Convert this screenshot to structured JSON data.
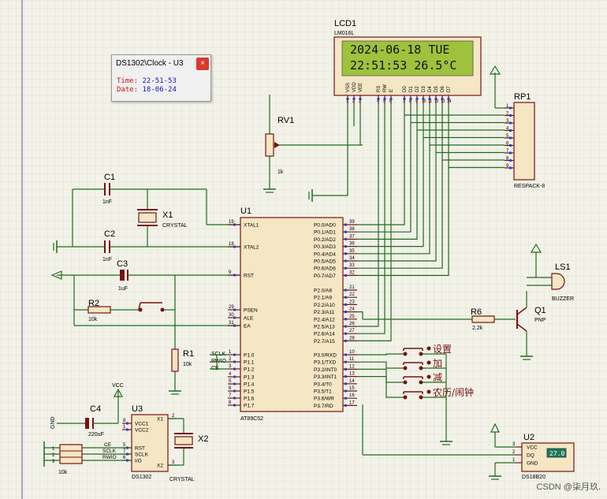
{
  "popup": {
    "title": "DS1302\\Clock - U3",
    "close_label": "×",
    "time_label": "Time:",
    "time_value": "22-51-53",
    "date_label": "Date:",
    "date_value": "18-06-24"
  },
  "lcd": {
    "ref": "LCD1",
    "model": "LM016L",
    "line1": "2024-06-18 TUE",
    "line2": "22:51:53  26.5°C",
    "pins": [
      "VSS",
      "VDD",
      "VEE",
      "RS",
      "RW",
      "E",
      "D0",
      "D1",
      "D2",
      "D3",
      "D4",
      "D5",
      "D6",
      "D7"
    ],
    "pin_numbers": [
      "1",
      "2",
      "3",
      "4",
      "5",
      "6",
      "7",
      "8",
      "9",
      "10",
      "11",
      "12",
      "13",
      "14"
    ]
  },
  "rv1": {
    "ref": "RV1",
    "value": "1k"
  },
  "rp1": {
    "ref": "RP1",
    "model": "RESPACK-8",
    "pins": [
      "1",
      "2",
      "3",
      "4",
      "5",
      "6",
      "7",
      "8",
      "9"
    ]
  },
  "c1": {
    "ref": "C1",
    "value": "1nF"
  },
  "c2": {
    "ref": "C2",
    "value": "1nF"
  },
  "c3": {
    "ref": "C3",
    "value": "1uF"
  },
  "c4": {
    "ref": "C4",
    "value": "220uF"
  },
  "x1": {
    "ref": "X1",
    "value": "CRYSTAL"
  },
  "x2": {
    "ref": "X2",
    "value": "CRYSTAL"
  },
  "r1": {
    "ref": "R1",
    "value": "10k"
  },
  "r2": {
    "ref": "R2",
    "value": "10k"
  },
  "r6": {
    "ref": "R6",
    "value": "2.2k"
  },
  "rn": {
    "value": "10k",
    "pins": [
      "1",
      "2",
      "3"
    ]
  },
  "ls1": {
    "ref": "LS1",
    "value": "BUZZER"
  },
  "q1": {
    "ref": "Q1",
    "value": "PNP"
  },
  "u1": {
    "ref": "U1",
    "model": "AT89C52",
    "left_pins": [
      {
        "num": "19",
        "name": "XTAL1"
      },
      {
        "num": "18",
        "name": "XTAL2"
      },
      {
        "num": "9",
        "name": "RST"
      },
      {
        "num": "29",
        "name": "PSEN"
      },
      {
        "num": "30",
        "name": "ALE"
      },
      {
        "num": "31",
        "name": "EA"
      },
      {
        "num": "1",
        "name": "P1.0"
      },
      {
        "num": "2",
        "name": "P1.1"
      },
      {
        "num": "3",
        "name": "P1.2"
      },
      {
        "num": "4",
        "name": "P1.3"
      },
      {
        "num": "5",
        "name": "P1.4"
      },
      {
        "num": "6",
        "name": "P1.5"
      },
      {
        "num": "7",
        "name": "P1.6"
      },
      {
        "num": "8",
        "name": "P1.7"
      }
    ],
    "right_pins": [
      {
        "num": "39",
        "name": "P0.0/AD0"
      },
      {
        "num": "38",
        "name": "P0.1/AD1"
      },
      {
        "num": "37",
        "name": "P0.2/AD2"
      },
      {
        "num": "36",
        "name": "P0.3/AD3"
      },
      {
        "num": "35",
        "name": "P0.4/AD4"
      },
      {
        "num": "34",
        "name": "P0.5/AD5"
      },
      {
        "num": "33",
        "name": "P0.6/AD6"
      },
      {
        "num": "32",
        "name": "P0.7/AD7"
      },
      {
        "num": "21",
        "name": "P2.0/A8"
      },
      {
        "num": "22",
        "name": "P2.1/A9"
      },
      {
        "num": "23",
        "name": "P2.2/A10"
      },
      {
        "num": "24",
        "name": "P2.3/A11"
      },
      {
        "num": "25",
        "name": "P2.4/A12"
      },
      {
        "num": "26",
        "name": "P2.5/A13"
      },
      {
        "num": "27",
        "name": "P2.6/A14"
      },
      {
        "num": "28",
        "name": "P2.7/A15"
      },
      {
        "num": "10",
        "name": "P3.0/RXD"
      },
      {
        "num": "11",
        "name": "P3.1/TXD"
      },
      {
        "num": "12",
        "name": "P3.2/INT0"
      },
      {
        "num": "13",
        "name": "P3.3/INT1"
      },
      {
        "num": "14",
        "name": "P3.4/T0"
      },
      {
        "num": "15",
        "name": "P3.5/T1"
      },
      {
        "num": "16",
        "name": "P3.6/WR"
      },
      {
        "num": "17",
        "name": "P3.7/RD"
      }
    ],
    "net_labels": [
      "SCLK",
      "RWIO",
      "CE"
    ]
  },
  "buttons": [
    "设置",
    "加",
    "减",
    "农历/闹钟"
  ],
  "u3": {
    "ref": "U3",
    "model": "DS1302",
    "vcc_label": "VCC",
    "gnd_label": "GND",
    "pins_left": [
      {
        "num": "8",
        "name": "VCC1"
      },
      {
        "num": "1",
        "name": "VCC2"
      },
      {
        "num": "5",
        "name": "RST"
      },
      {
        "num": "7",
        "name": "SCLK"
      },
      {
        "num": "6",
        "name": "I/O"
      }
    ],
    "pins_right": [
      {
        "num": "2",
        "name": "X1"
      },
      {
        "num": "3",
        "name": "X2"
      }
    ],
    "net_labels": [
      "CE",
      "SCLK",
      "RWIO"
    ]
  },
  "u2": {
    "ref": "U2",
    "model": "DS18B20",
    "pins": [
      {
        "num": "3",
        "name": "VCC"
      },
      {
        "num": "2",
        "name": "DQ"
      },
      {
        "num": "1",
        "name": "GND"
      }
    ],
    "reading": "27.0"
  },
  "watermark": "CSDN @柒月玖.",
  "colors": {
    "wire": "#1f6b1f",
    "component": "#7a1010",
    "chip_fill": "#f5e6c4",
    "lcd_bg": "#9ec23c",
    "pin_text": "#1a1a1a",
    "button_text": "#7a1010"
  }
}
